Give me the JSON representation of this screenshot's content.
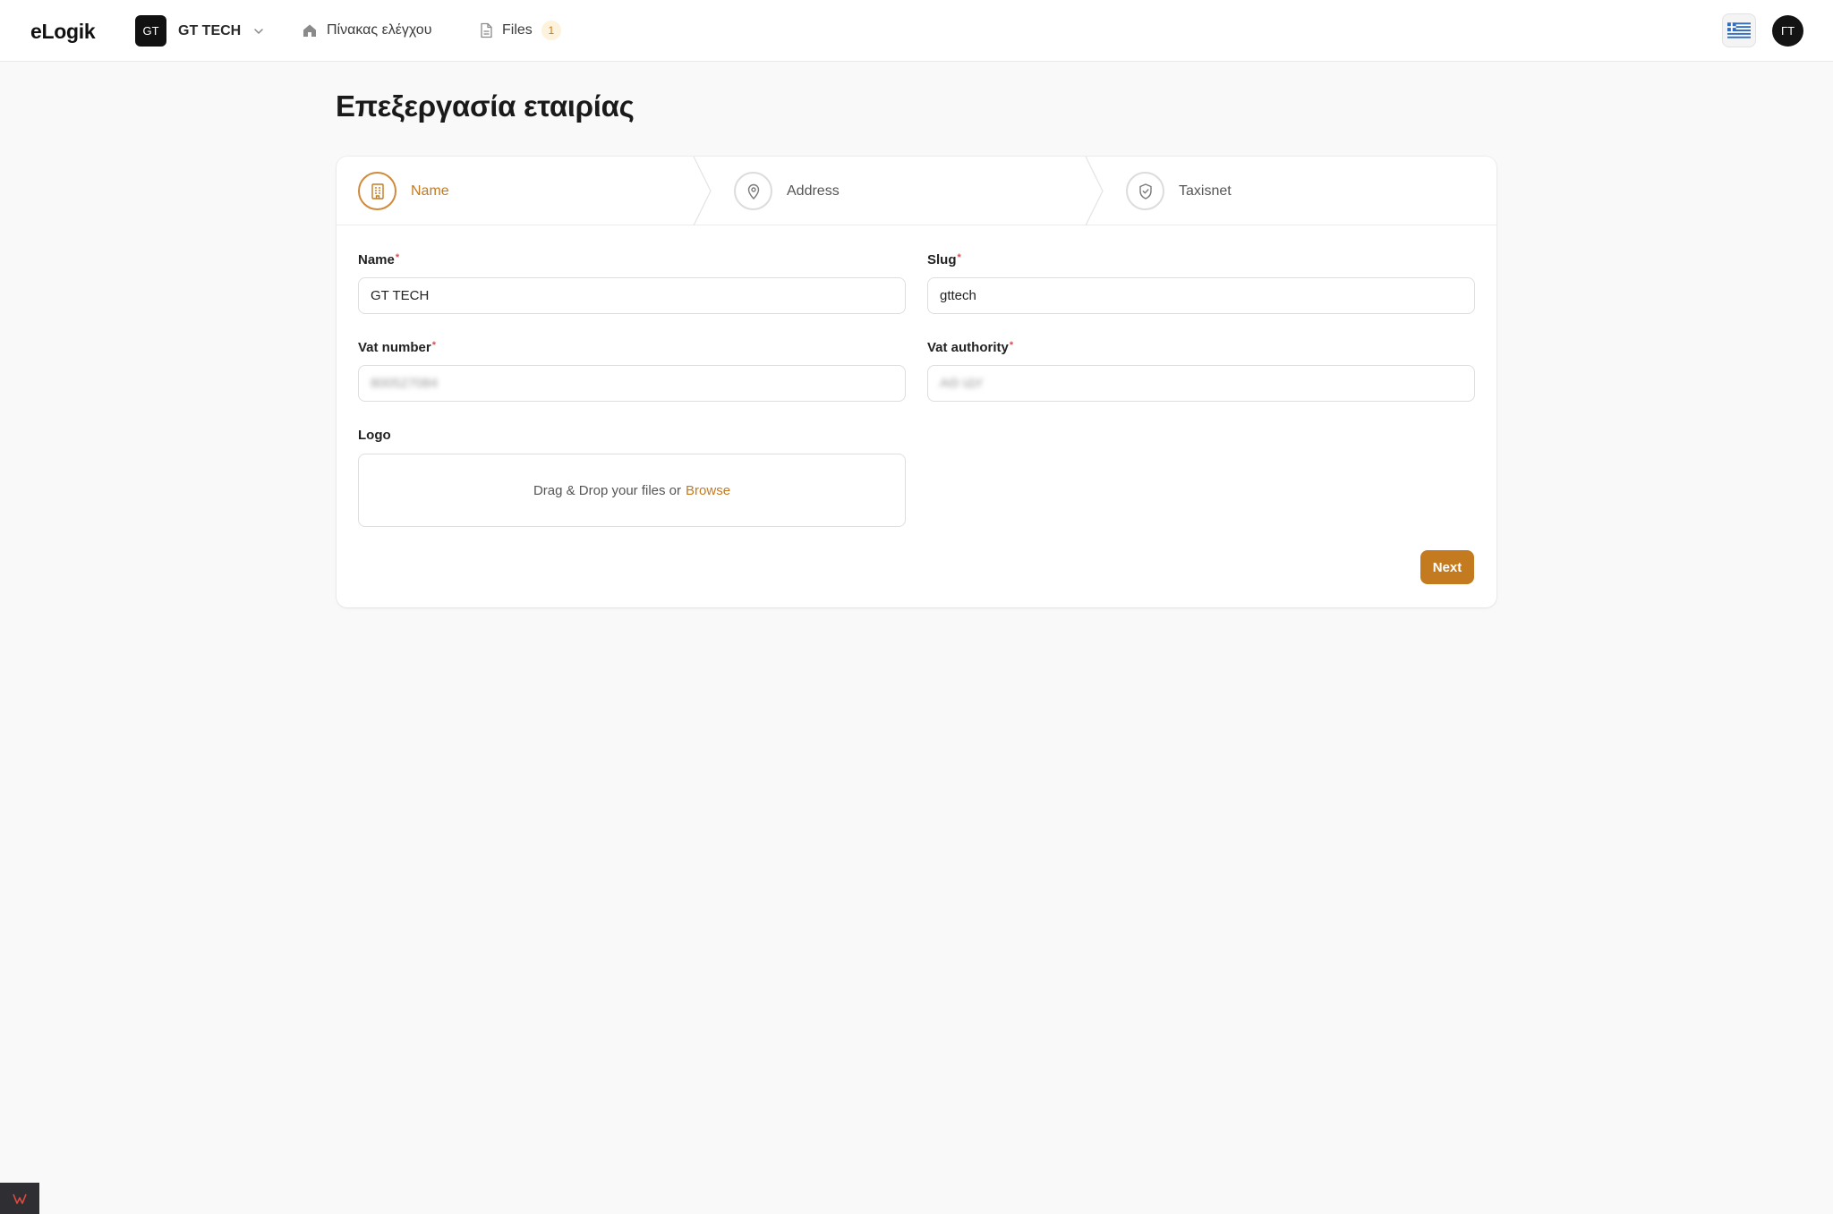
{
  "app": {
    "brand": "eLogik"
  },
  "header": {
    "company_badge": "GT",
    "company_name": "GT TECH",
    "nav": {
      "dashboard_label": "Πίνακας ελέγχου",
      "files_label": "Files",
      "files_count": "1"
    },
    "avatar_initials": "ΓΤ"
  },
  "page": {
    "title": "Επεξεργασία εταιρίας"
  },
  "stepper": {
    "steps": [
      {
        "label": "Name",
        "icon": "building-icon",
        "active": true
      },
      {
        "label": "Address",
        "icon": "map-pin-icon",
        "active": false
      },
      {
        "label": "Taxisnet",
        "icon": "shield-check-icon",
        "active": false
      }
    ]
  },
  "form": {
    "name": {
      "label": "Name",
      "required_mark": "*",
      "value": "GT TECH"
    },
    "slug": {
      "label": "Slug",
      "required_mark": "*",
      "value": "gttech"
    },
    "vat_number": {
      "label": "Vat number",
      "required_mark": "*",
      "value": "800527084"
    },
    "vat_authority": {
      "label": "Vat authority",
      "required_mark": "*",
      "value": "ΑΘ ΙΔΥ"
    },
    "logo": {
      "label": "Logo",
      "dropzone_text": "Drag & Drop your files or",
      "browse_label": "Browse"
    },
    "next_label": "Next"
  },
  "colors": {
    "accent": "#c47a1f",
    "required": "#e5484d",
    "background": "#f9f9f9"
  }
}
